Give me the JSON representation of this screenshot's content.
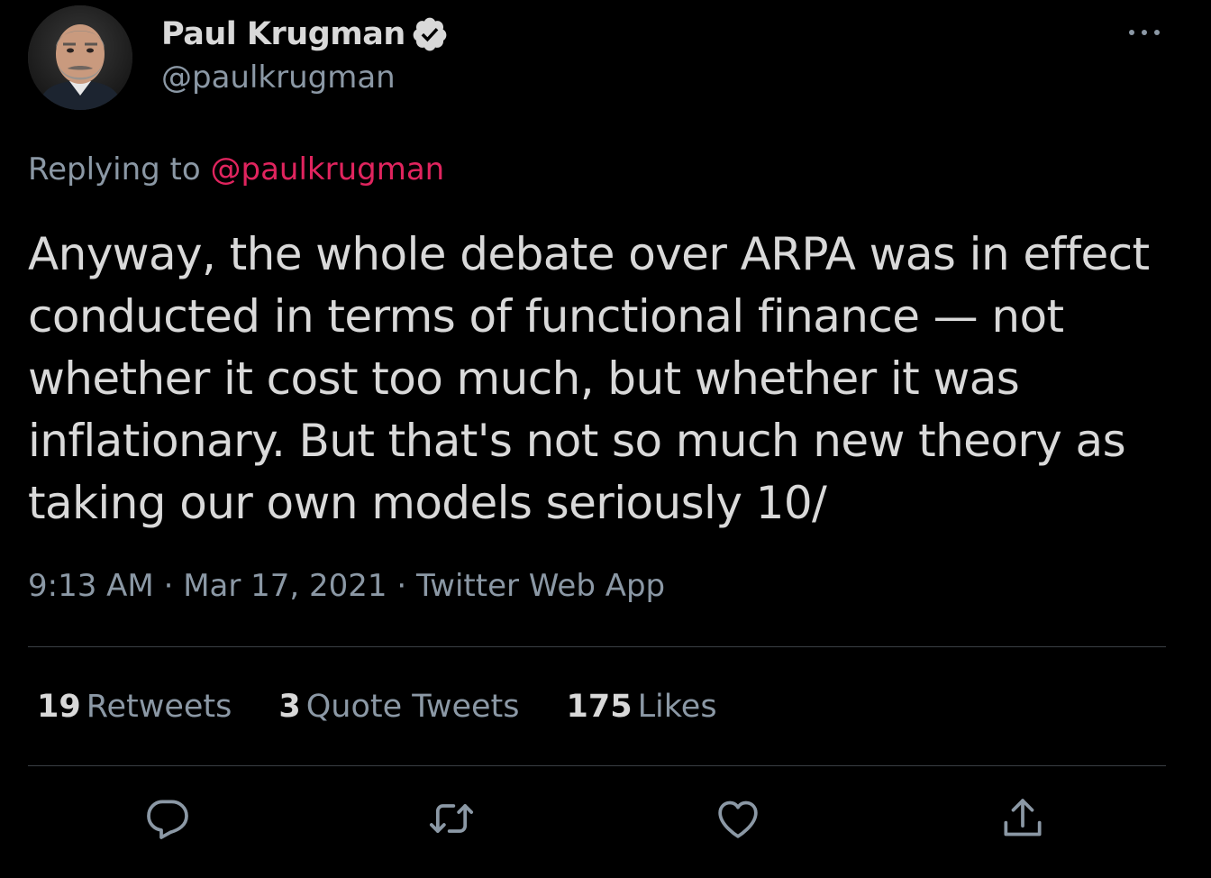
{
  "author": {
    "display_name": "Paul Krugman",
    "handle": "@paulkrugman",
    "verified": true,
    "avatar_icon": "profile-photo"
  },
  "reply_context": {
    "prefix": "Replying to",
    "target": "@paulkrugman"
  },
  "tweet": {
    "text_lines": [
      "Anyway, the whole debate over ARPA was in effect",
      "conducted in terms of functional finance — not",
      "whether it cost too much, but whether it was",
      "inflationary. But that's not so much new theory as",
      "taking our own models seriously 10/"
    ]
  },
  "meta": {
    "time": "9:13 AM",
    "date": "Mar 17, 2021",
    "source": "Twitter Web App",
    "separator": "·"
  },
  "stats": {
    "retweets": {
      "count": "19",
      "label": "Retweets"
    },
    "quote_tweets": {
      "count": "3",
      "label": "Quote Tweets"
    },
    "likes": {
      "count": "175",
      "label": "Likes"
    }
  },
  "actions": {
    "reply_icon": "reply-icon",
    "retweet_icon": "retweet-icon",
    "like_icon": "heart-icon",
    "share_icon": "share-icon",
    "more_icon": "more-icon"
  },
  "colors": {
    "background": "#000000",
    "primary_text": "#d9d9d9",
    "secondary_text": "#8b98a5",
    "mention": "#e0245e",
    "divider": "#3a3f44"
  }
}
